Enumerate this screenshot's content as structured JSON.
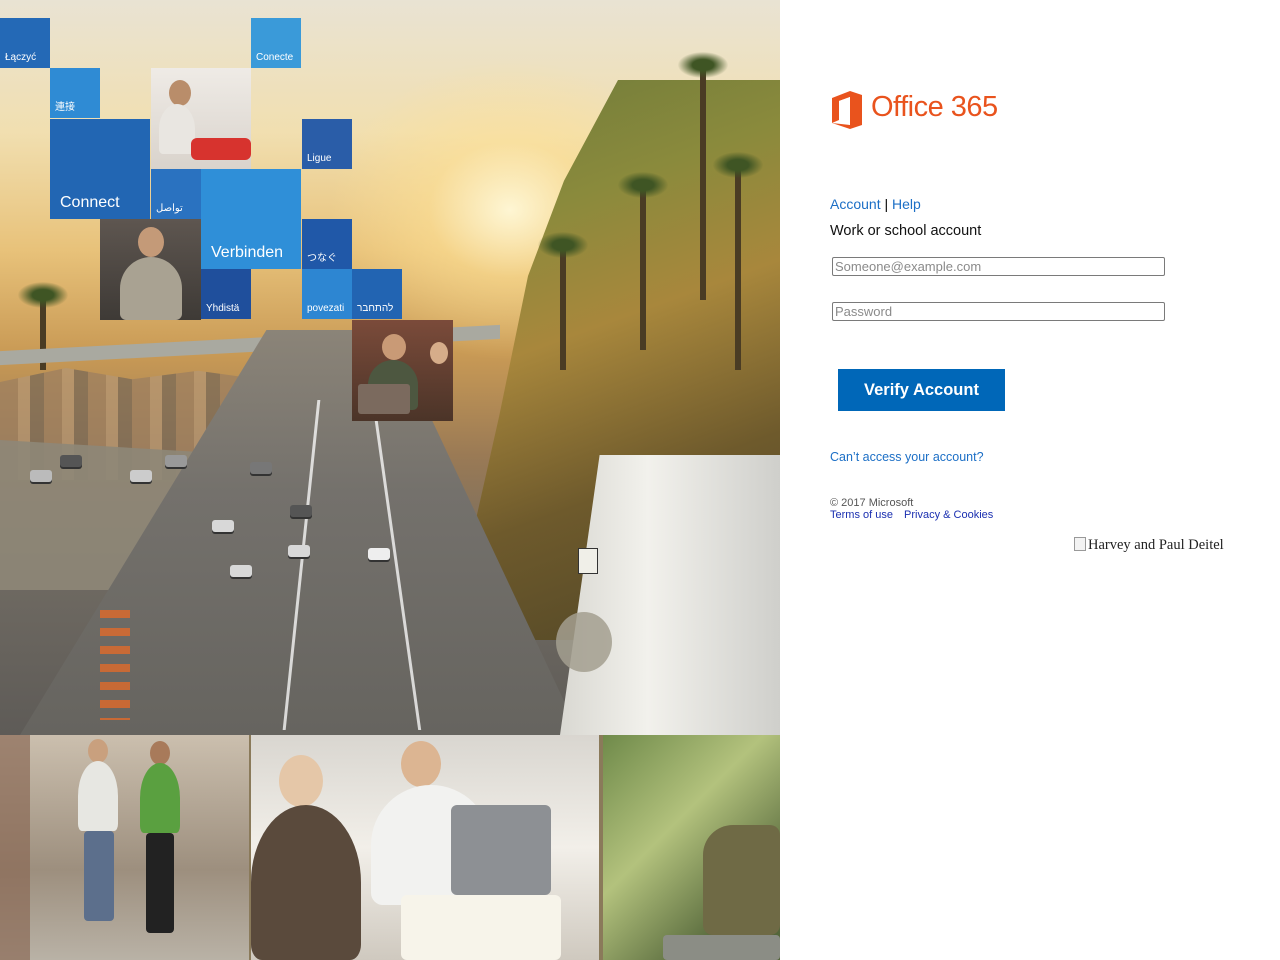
{
  "brand": {
    "logo_text": "Office 365",
    "logo_color": "#e9531d"
  },
  "hero": {
    "tiles": [
      {
        "label": "Łączyć"
      },
      {
        "label": "Conecte"
      },
      {
        "label": "連接"
      },
      {
        "label": "Ligue"
      },
      {
        "label": "Connect"
      },
      {
        "label": "تواصل"
      },
      {
        "label": "Verbinden"
      },
      {
        "label": "つなぐ"
      },
      {
        "label": "Yhdistä"
      },
      {
        "label": "povezati"
      },
      {
        "label": "להתחבר"
      }
    ]
  },
  "nav": {
    "account": "Account",
    "separator": "|",
    "help": "Help"
  },
  "form": {
    "subtitle": "Work or school account",
    "email_placeholder": "Someone@example.com",
    "password_placeholder": "Password",
    "submit_label": "Verify Account",
    "cant_access": "Can’t access your account?"
  },
  "footer": {
    "copyright": "© 2017 Microsoft",
    "terms": "Terms of use",
    "privacy": "Privacy & Cookies"
  },
  "broken_image": {
    "alt": "Harvey and Paul Deitel"
  },
  "colors": {
    "accent": "#0067b8",
    "link": "#1c6fc6",
    "tile_blue": "#2b78c8",
    "tile_dark": "#1d4f9a"
  }
}
